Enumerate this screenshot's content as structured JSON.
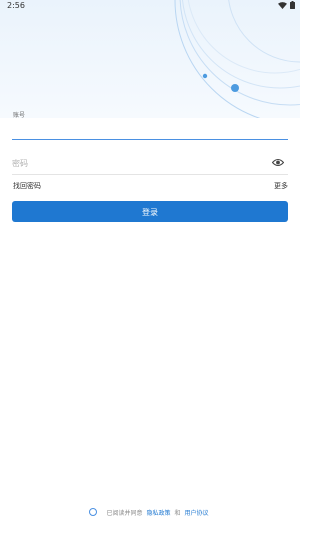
{
  "status_bar": {
    "time": "2:56"
  },
  "login_form": {
    "account_label": "账号",
    "account_value": "",
    "password_placeholder": "密码",
    "forgot_password_label": "找回密码",
    "more_label": "更多",
    "login_button_label": "登录"
  },
  "agreement": {
    "prefix_text": "已阅读并同意",
    "privacy_link": "隐私政策",
    "conjunction": "和",
    "terms_link": "用户协议"
  },
  "icons": {
    "wifi": "wifi-icon",
    "battery": "battery-icon",
    "show_password": "eye-icon",
    "agreement_checkbox": "radio-circle-icon"
  },
  "colors": {
    "accent": "#1f78d1",
    "header_background": "#eaf3fc"
  }
}
